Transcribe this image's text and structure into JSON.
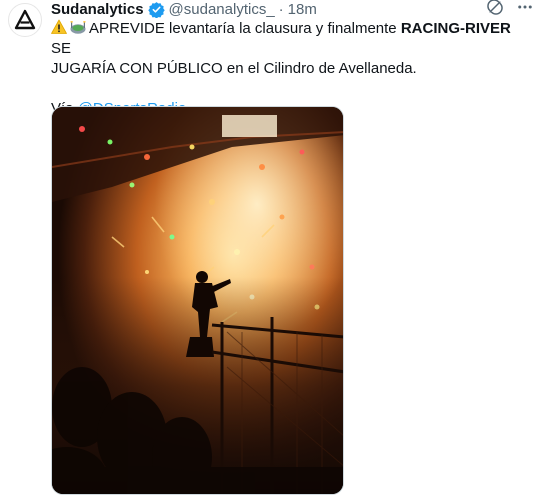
{
  "author": {
    "name": "Sudanalytics",
    "handle": "@sudanalytics_",
    "separator": "·",
    "time": "18m",
    "avatar_icon": "triangle-a-logo-icon"
  },
  "icons": {
    "verified": "verified-badge-icon",
    "grok": "grok-icon",
    "more": "more-options-icon",
    "warning": "warning-emoji-icon",
    "stadium": "stadium-emoji-icon"
  },
  "tweet": {
    "line1_pre": "APREVIDE levantaría la clausura y finalmente ",
    "line1_bold": "RACING-RIVER",
    "line1_post": " SE",
    "line2": "JUGARÍA CON PÚBLICO en el Cilindro de Avellaneda.",
    "via_prefix": "Vía ",
    "via_link": "@DSportsRadio",
    "via_suffix": "."
  },
  "media": {
    "description_icon": "stadium-fireworks-photo"
  },
  "colors": {
    "link": "#1d9bf0",
    "verified": "#1d9bf0",
    "secondary_text": "#536471",
    "primary_text": "#0f1419"
  }
}
